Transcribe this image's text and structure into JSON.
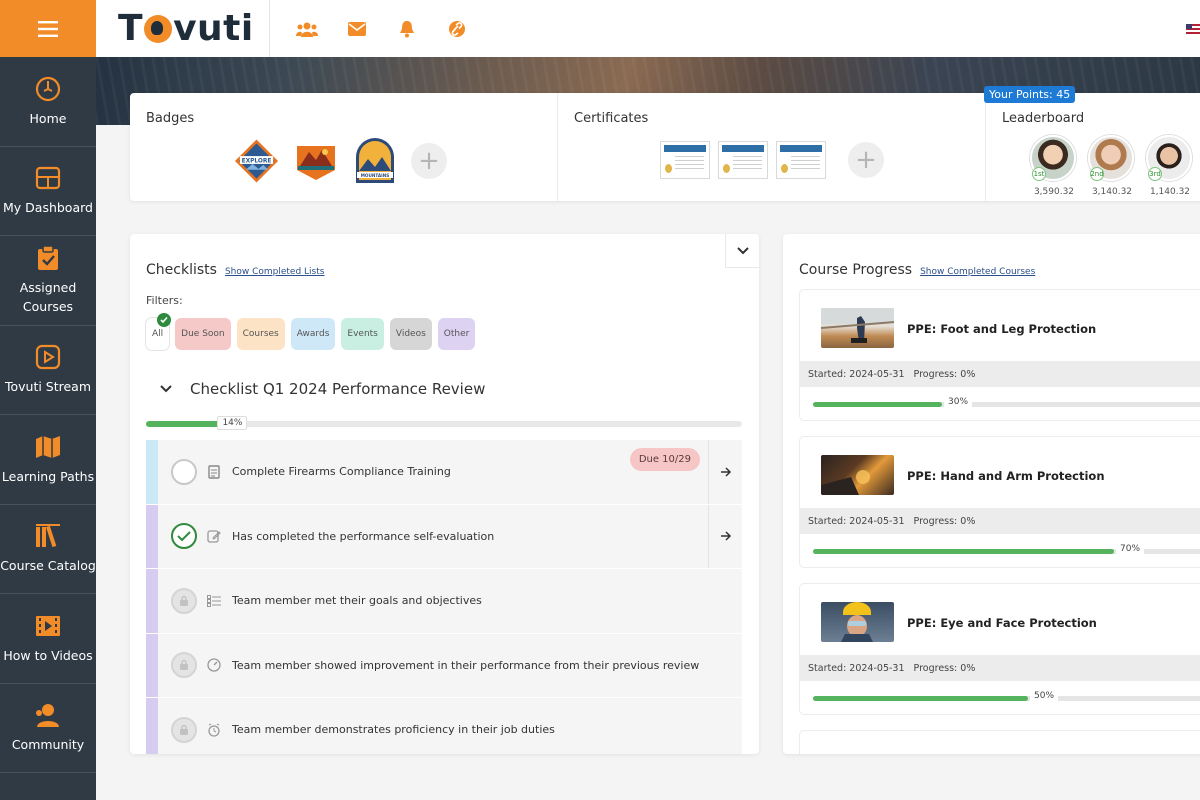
{
  "app": {
    "brand": "Tovuti"
  },
  "colors": {
    "accent": "#f28c28",
    "sidebar": "#2f3a45",
    "success": "#55b35d",
    "link": "#2b4f8a",
    "points": "#1d7bd6"
  },
  "sidebar": {
    "items": [
      {
        "label": "Home",
        "icon": "compass-icon"
      },
      {
        "label": "My Dashboard",
        "icon": "dashboard-icon"
      },
      {
        "label": "Assigned\nCourses",
        "icon": "clipboard-icon"
      },
      {
        "label": "Tovuti Stream",
        "icon": "play-icon"
      },
      {
        "label": "Learning Paths",
        "icon": "map-icon"
      },
      {
        "label": "Course Catalog",
        "icon": "books-icon"
      },
      {
        "label": "How to Videos",
        "icon": "film-icon"
      },
      {
        "label": "Community",
        "icon": "users-icon"
      }
    ]
  },
  "topbar": {
    "icons": [
      "people-icon",
      "mail-icon",
      "bell-icon",
      "link-icon"
    ]
  },
  "badges_section": {
    "title": "Badges",
    "badges": [
      "explore-badge",
      "adventure-badge",
      "mountains-badge"
    ]
  },
  "certificates_section": {
    "title": "Certificates",
    "count": 3
  },
  "leaderboard": {
    "title": "Leaderboard",
    "points_label": "Your Points: 45",
    "leaders": [
      {
        "rank": "1st",
        "score": "3,590.32"
      },
      {
        "rank": "2nd",
        "score": "3,140.32"
      },
      {
        "rank": "3rd",
        "score": "1,140.32"
      }
    ]
  },
  "checklists": {
    "title": "Checklists",
    "link": "Show Completed Lists",
    "filters_label": "Filters:",
    "filters": [
      {
        "label": "All",
        "color": "#ffffff",
        "active": true
      },
      {
        "label": "Due Soon",
        "color": "#f6c9c9"
      },
      {
        "label": "Courses",
        "color": "#fde3c6"
      },
      {
        "label": "Awards",
        "color": "#cfe8f7"
      },
      {
        "label": "Events",
        "color": "#c9efe3"
      },
      {
        "label": "Videos",
        "color": "#d6d6d6"
      },
      {
        "label": "Other",
        "color": "#ddd2f2"
      }
    ],
    "checklist_title": "Checklist Q1 2024 Performance Review",
    "progress": 14,
    "progress_label": "14%",
    "tasks": [
      {
        "text": "Complete Firearms Compliance Training",
        "state": "open",
        "stripe": "#cbe8f6",
        "icon": "document-icon",
        "due": "Due 10/29",
        "arrow": true
      },
      {
        "text": "Has completed the performance self-evaluation",
        "state": "done",
        "stripe": "#d5ccef",
        "icon": "edit-icon",
        "arrow": true
      },
      {
        "text": "Team member met their goals and objectives",
        "state": "locked",
        "stripe": "#d5ccef",
        "icon": "list-icon"
      },
      {
        "text": "Team member showed improvement in their performance from their previous review",
        "state": "locked",
        "stripe": "#d5ccef",
        "icon": "gauge-icon"
      },
      {
        "text": "Team member demonstrates proficiency in their job duties",
        "state": "locked",
        "stripe": "#d5ccef",
        "icon": "alarm-icon"
      }
    ]
  },
  "course_progress": {
    "title": "Course Progress",
    "link": "Show Completed Courses",
    "courses": [
      {
        "title": "PPE: Foot and Leg Protection",
        "started": "Started: 2024-05-31",
        "progress_text": "Progress: 0%",
        "bar": 30,
        "bar_label": "30%"
      },
      {
        "title": "PPE: Hand and Arm Protection",
        "started": "Started: 2024-05-31",
        "progress_text": "Progress: 0%",
        "bar": 70,
        "bar_label": "70%"
      },
      {
        "title": "PPE: Eye and Face Protection",
        "started": "Started: 2024-05-31",
        "progress_text": "Progress: 0%",
        "bar": 50,
        "bar_label": "50%"
      }
    ]
  }
}
